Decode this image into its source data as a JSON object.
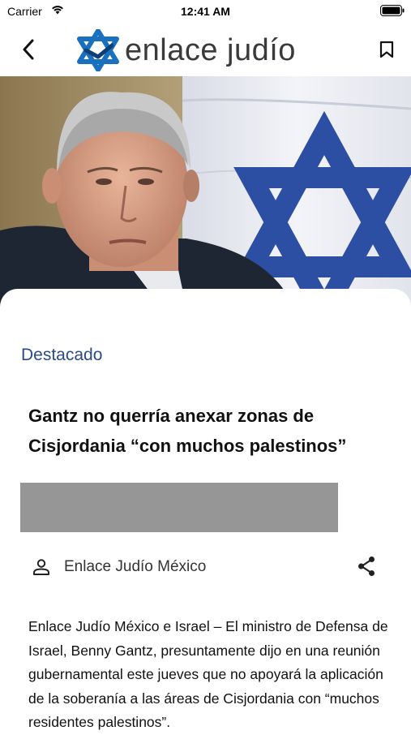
{
  "status_bar": {
    "carrier": "Carrier",
    "time": "12:41 AM"
  },
  "nav": {
    "logo_text": "enlace judío",
    "brand_color": "#1a6fbf",
    "back_icon": "chevron-left-icon",
    "bookmark_icon": "bookmark-icon"
  },
  "article": {
    "category": "Destacado",
    "title": "Gantz no querría anexar zonas de Cisjordania “con muchos palestinos”",
    "author": "Enlace Judío México",
    "body": "Enlace Judío México e Israel – El ministro de Defensa de Israel, Benny Gantz, presuntamente dijo en una reunión gubernamental este jueves que no apoyará la aplicación de la soberanía a las áreas de Cisjordania con “muchos residentes palestinos”.",
    "category_color": "#2b4a87"
  }
}
